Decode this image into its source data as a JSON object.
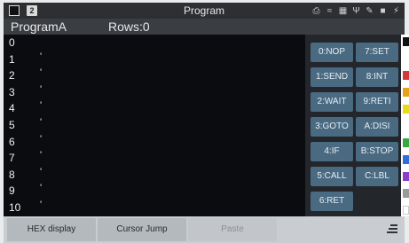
{
  "status_bar": {
    "page_number": "2",
    "title": "Program",
    "icons": [
      "printer-icon",
      "wifi-icon",
      "network-icon",
      "usb-icon",
      "pen-icon",
      "save-icon",
      "power-icon"
    ]
  },
  "header": {
    "program_name": "ProgramA",
    "rows_label": "Rows:0"
  },
  "editor": {
    "lines": [
      {
        "num": "0",
        "mark": ""
      },
      {
        "num": "1",
        "mark": "'"
      },
      {
        "num": "2",
        "mark": "'"
      },
      {
        "num": "3",
        "mark": "'"
      },
      {
        "num": "4",
        "mark": "'"
      },
      {
        "num": "5",
        "mark": "'"
      },
      {
        "num": "6",
        "mark": "'"
      },
      {
        "num": "7",
        "mark": "'"
      },
      {
        "num": "8",
        "mark": "'"
      },
      {
        "num": "9",
        "mark": "'"
      },
      {
        "num": "10",
        "mark": "'"
      }
    ]
  },
  "instructions": [
    "0:NOP",
    "7:SET",
    "1:SEND",
    "8:INT",
    "2:WAIT",
    "9:RETI",
    "3:GOTO",
    "A:DISI",
    "4:IF",
    "B:STOP",
    "5:CALL",
    "C:LBL",
    "6:RET"
  ],
  "color_swatches": [
    "#111111",
    "#d23a3a",
    "#e6a21d",
    "#e8d91e",
    "#3aa845",
    "#2f6fd6",
    "#8a3fc7",
    "#9a9a9a",
    "#ffffff"
  ],
  "bottom_bar": {
    "hex_display": "HEX display",
    "cursor_jump": "Cursor Jump",
    "paste": "Paste"
  }
}
